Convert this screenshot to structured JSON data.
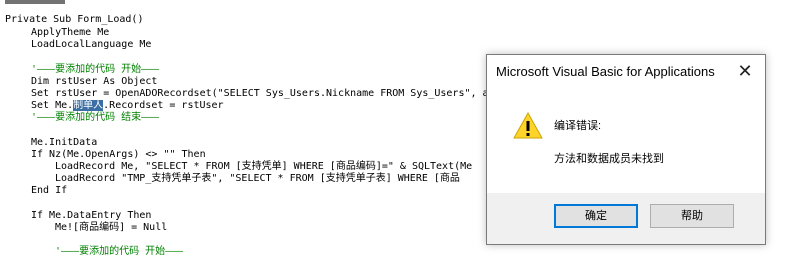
{
  "code": {
    "line1": "Private Sub Form_Load()",
    "line2": "ApplyTheme Me",
    "line3": "LoadLocalLanguage Me",
    "line4": "'———要添加的代码 开始———",
    "line5": "Dim rstUser As Object",
    "line6": "Set rstUser = OpenADORecordset(\"SELECT Sys_Users.Nickname FROM Sys_Users\", a",
    "line7_pre": "Set Me.",
    "line7_hl": "制单人",
    "line7_post": ".Recordset = rstUser",
    "line8": "'———要添加的代码 结束———",
    "line9": "Me.InitData",
    "line10": "If Nz(Me.OpenArgs) <> \"\" Then",
    "line11": "LoadRecord Me, \"SELECT * FROM [支持凭单] WHERE [商品编码]=\" & SQLText(Me",
    "line12": "LoadRecord \"TMP_支持凭单子表\", \"SELECT * FROM [支持凭单子表] WHERE [商品",
    "line13": "End If",
    "line14": "If Me.DataEntry Then",
    "line15": "Me![商品编码] = Null",
    "line16": "'———要添加的代码 开始———"
  },
  "dialog": {
    "title": "Microsoft Visual Basic for Applications",
    "close_glyph": "✕",
    "icon": "warning-icon",
    "message_title": "编译错误:",
    "message_detail": "方法和数据成员未找到",
    "ok_label": "确定",
    "help_label": "帮助",
    "accent": "#0078d7"
  }
}
